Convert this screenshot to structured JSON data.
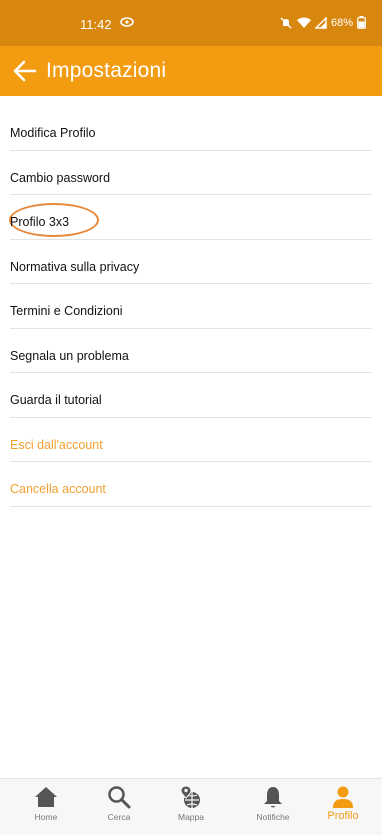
{
  "status_bar": {
    "time": "11:42",
    "battery": "68%"
  },
  "header": {
    "title": "Impostazioni"
  },
  "settings": {
    "items": [
      {
        "label": "Modifica Profilo",
        "style": "default"
      },
      {
        "label": "Cambio password",
        "style": "default"
      },
      {
        "label": "Profilo 3x3",
        "style": "default",
        "circled": true
      },
      {
        "label": "Normativa sulla privacy",
        "style": "default"
      },
      {
        "label": "Termini e Condizioni",
        "style": "default"
      },
      {
        "label": "Segnala un problema",
        "style": "default"
      },
      {
        "label": "Guarda il tutorial",
        "style": "default"
      },
      {
        "label": "Esci dall'account",
        "style": "accent"
      },
      {
        "label": "Cancella account",
        "style": "accent"
      }
    ]
  },
  "bottom_nav": {
    "items": [
      {
        "label": "Home",
        "icon": "home-icon",
        "active": false
      },
      {
        "label": "Cerca",
        "icon": "search-icon",
        "active": false
      },
      {
        "label": "Mappa",
        "icon": "map-globe-icon",
        "active": false
      },
      {
        "label": "Notifiche",
        "icon": "bell-icon",
        "active": false
      },
      {
        "label": "Profilo",
        "icon": "user-icon",
        "active": true
      }
    ]
  },
  "colors": {
    "status_bar": "#d8870e",
    "header": "#f39c12",
    "accent_text": "#f0a030",
    "highlight_oval": "#e8893a",
    "nav_inactive": "#777777",
    "nav_active": "#f39c12"
  }
}
